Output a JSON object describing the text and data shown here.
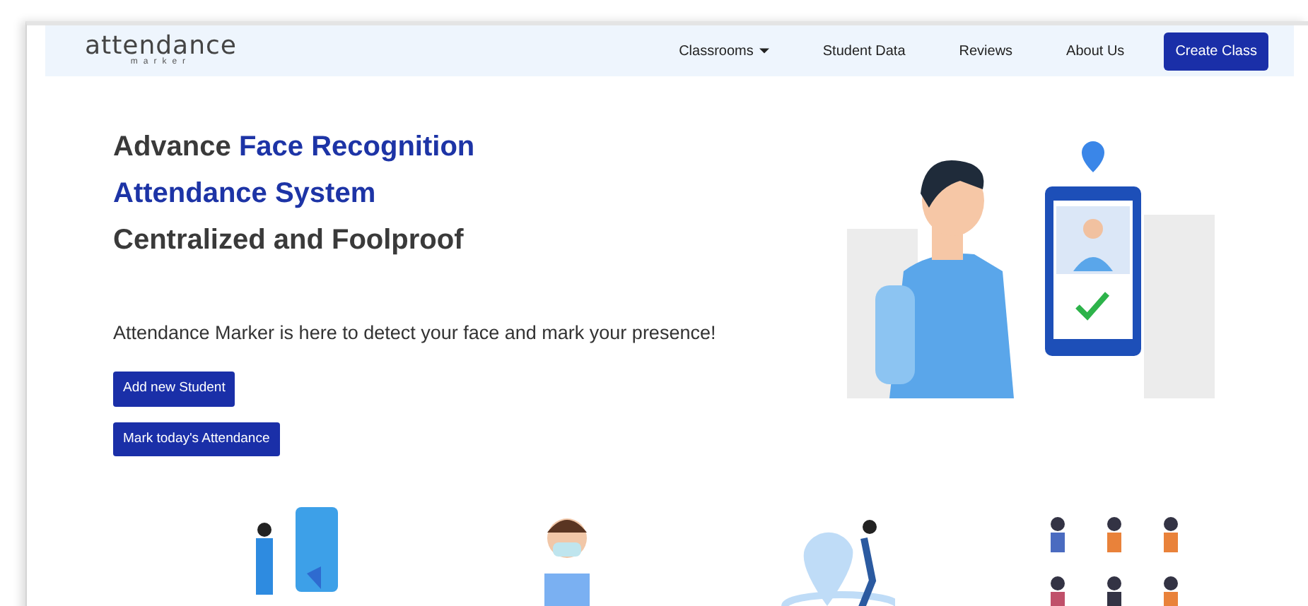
{
  "navbar": {
    "logo": {
      "title": "attendance",
      "subtitle": "marker"
    },
    "links": [
      {
        "label": "Classrooms",
        "dropdown": true
      },
      {
        "label": "Student Data",
        "dropdown": false
      },
      {
        "label": "Reviews",
        "dropdown": false
      },
      {
        "label": "About Us",
        "dropdown": false
      }
    ],
    "cta": "Create Class"
  },
  "hero": {
    "heading_lines": [
      [
        {
          "text": "Advance ",
          "highlight": false
        },
        {
          "text": "Face Recognition",
          "highlight": true
        }
      ],
      [
        {
          "text": "Attendance System",
          "highlight": true
        }
      ],
      [
        {
          "text": "Centralized and Foolproof",
          "highlight": false
        }
      ]
    ],
    "tagline": "Attendance Marker is here to detect your face and mark your presence!",
    "buttons": [
      "Add new Student",
      "Mark today's Attendance"
    ]
  },
  "features": [
    {
      "kind": "phone"
    },
    {
      "kind": "mask"
    },
    {
      "kind": "location"
    },
    {
      "kind": "people"
    }
  ]
}
